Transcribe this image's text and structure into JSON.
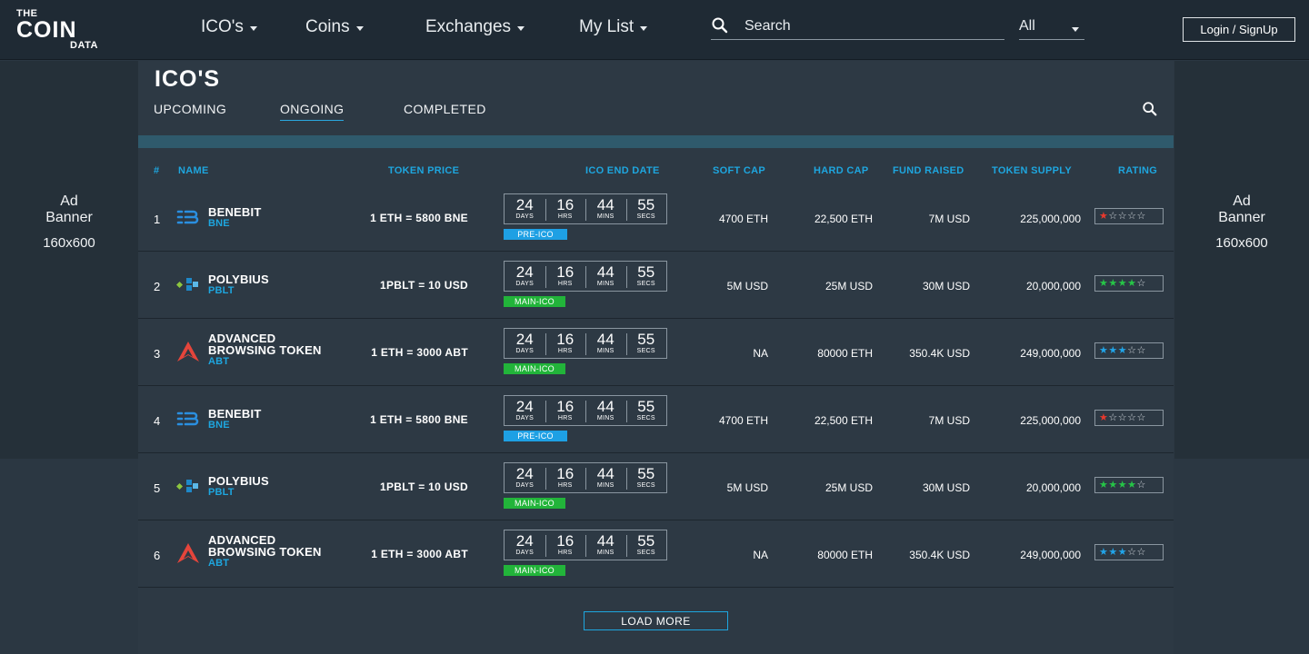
{
  "logo": {
    "line1": "THE",
    "line2": "COIN",
    "line3": "DATA"
  },
  "nav": [
    {
      "label": "ICO's"
    },
    {
      "label": "Coins"
    },
    {
      "label": "Exchanges"
    },
    {
      "label": "My List"
    }
  ],
  "search": {
    "placeholder": "Search"
  },
  "filter": {
    "selected": "All"
  },
  "login": {
    "label": "Login / SignUp"
  },
  "ad": {
    "line1": "Ad",
    "line2": "Banner",
    "size": "160x600"
  },
  "page": {
    "title": "ICO'S"
  },
  "tabs": [
    {
      "label": "UPCOMING"
    },
    {
      "label": "ONGOING"
    },
    {
      "label": "COMPLETED"
    }
  ],
  "columns": {
    "num": "#",
    "name": "NAME",
    "price": "TOKEN PRICE",
    "end": "ICO END DATE",
    "soft": "SOFT CAP",
    "hard": "HARD CAP",
    "fund": "FUND RAISED",
    "supply": "TOKEN SUPPLY",
    "rating": "RATING"
  },
  "timer_labels": {
    "days": "DAYS",
    "hrs": "HRS",
    "mins": "MINS",
    "secs": "SECS"
  },
  "rows": [
    {
      "num": "1",
      "name": "BENEBIT",
      "symbol": "BNE",
      "icon": "benebit-icon",
      "price": "1 ETH = 5800 BNE",
      "days": "24",
      "hrs": "16",
      "mins": "44",
      "secs": "55",
      "stage": "PRE-ICO",
      "soft": "4700 ETH",
      "hard": "22,500 ETH",
      "fund": "7M USD",
      "supply": "225,000,000",
      "rating": 1
    },
    {
      "num": "2",
      "name": "POLYBIUS",
      "symbol": "PBLT",
      "icon": "polybius-icon",
      "price": "1PBLT = 10 USD",
      "days": "24",
      "hrs": "16",
      "mins": "44",
      "secs": "55",
      "stage": "MAIN-ICO",
      "soft": "5M USD",
      "hard": "25M USD",
      "fund": "30M USD",
      "supply": "20,000,000",
      "rating": 4
    },
    {
      "num": "3",
      "name": "ADVANCED BROWSING TOKEN",
      "symbol": "ABT",
      "icon": "abt-icon",
      "price": "1 ETH = 3000 ABT",
      "days": "24",
      "hrs": "16",
      "mins": "44",
      "secs": "55",
      "stage": "MAIN-ICO",
      "soft": "NA",
      "hard": "80000 ETH",
      "fund": "350.4K USD",
      "supply": "249,000,000",
      "rating": 3
    },
    {
      "num": "4",
      "name": "BENEBIT",
      "symbol": "BNE",
      "icon": "benebit-icon",
      "price": "1 ETH = 5800 BNE",
      "days": "24",
      "hrs": "16",
      "mins": "44",
      "secs": "55",
      "stage": "PRE-ICO",
      "soft": "4700 ETH",
      "hard": "22,500 ETH",
      "fund": "7M USD",
      "supply": "225,000,000",
      "rating": 1
    },
    {
      "num": "5",
      "name": "POLYBIUS",
      "symbol": "PBLT",
      "icon": "polybius-icon",
      "price": "1PBLT = 10 USD",
      "days": "24",
      "hrs": "16",
      "mins": "44",
      "secs": "55",
      "stage": "MAIN-ICO",
      "soft": "5M USD",
      "hard": "25M USD",
      "fund": "30M USD",
      "supply": "20,000,000",
      "rating": 4
    },
    {
      "num": "6",
      "name": "ADVANCED BROWSING TOKEN",
      "symbol": "ABT",
      "icon": "abt-icon",
      "price": "1 ETH = 3000 ABT",
      "days": "24",
      "hrs": "16",
      "mins": "44",
      "secs": "55",
      "stage": "MAIN-ICO",
      "soft": "NA",
      "hard": "80000 ETH",
      "fund": "350.4K USD",
      "supply": "249,000,000",
      "rating": 3
    }
  ],
  "load_more": {
    "label": "LOAD MORE"
  },
  "colors": {
    "accent": "#1ea6df",
    "header": "#1f2a34",
    "panel": "#2d3944",
    "pre_ico": "#1ea0e4",
    "main_ico": "#22b43a",
    "star_red": "#e8392d",
    "star_green": "#26c447",
    "star_blue": "#21a4e8"
  }
}
